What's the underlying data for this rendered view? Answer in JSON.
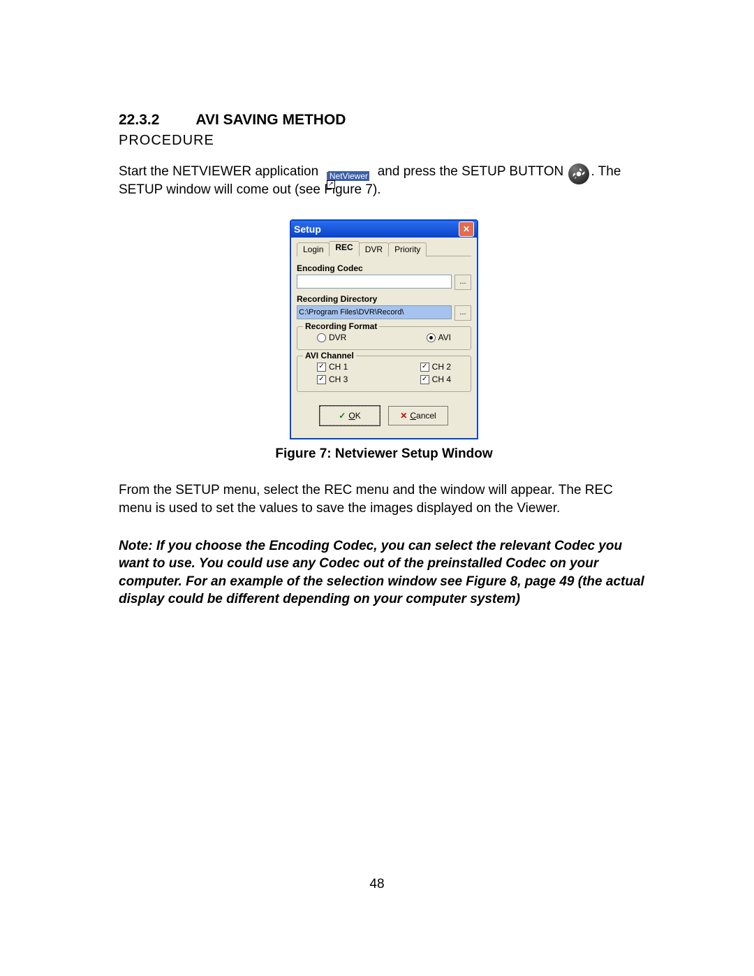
{
  "heading": {
    "number": "22.3.2",
    "title": "AVI SAVING METHOD"
  },
  "procedure_label": "PROCEDURE",
  "intro": {
    "t1": "Start the NETVIEWER application ",
    "t2": " and press the SETUP BUTTON ",
    "t3": ". The SETUP window will come out (see Figure 7)."
  },
  "netviewer_shortcut_label": "NetViewer",
  "dialog": {
    "title": "Setup",
    "close_glyph": "✕",
    "tabs": [
      "Login",
      "REC",
      "DVR",
      "Priority"
    ],
    "active_tab_index": 1,
    "encoding_codec_label": "Encoding Codec",
    "encoding_codec_value": "",
    "recording_dir_label": "Recording Directory",
    "recording_dir_value": "C:\\Program Files\\DVR\\Record\\",
    "browse_label": "...",
    "rec_format": {
      "legend": "Recording Format",
      "options": [
        {
          "label": "DVR",
          "selected": false
        },
        {
          "label": "AVI",
          "selected": true
        }
      ]
    },
    "avi_channel": {
      "legend": "AVI Channel",
      "rows": [
        [
          {
            "label": "CH 1",
            "checked": true
          },
          {
            "label": "CH 2",
            "checked": true
          }
        ],
        [
          {
            "label": "CH 3",
            "checked": true
          },
          {
            "label": "CH 4",
            "checked": true
          }
        ]
      ]
    },
    "ok_label_prefix": "O",
    "ok_label_suffix": "K",
    "cancel_label_prefix": "C",
    "cancel_label_suffix": "ancel"
  },
  "caption": "Figure 7: Netviewer Setup Window",
  "para_after": "From the SETUP menu, select the REC menu and the window will appear. The REC menu is used to set the values to save the images displayed on the Viewer.",
  "note": "Note: If you choose the Encoding Codec, you can select the relevant Codec you want to use. You could use any Codec out of the preinstalled Codec on your computer.  For an example of the selection window see Figure 8, page 49 (the actual display could be different depending on your computer system)",
  "page_number": "48"
}
